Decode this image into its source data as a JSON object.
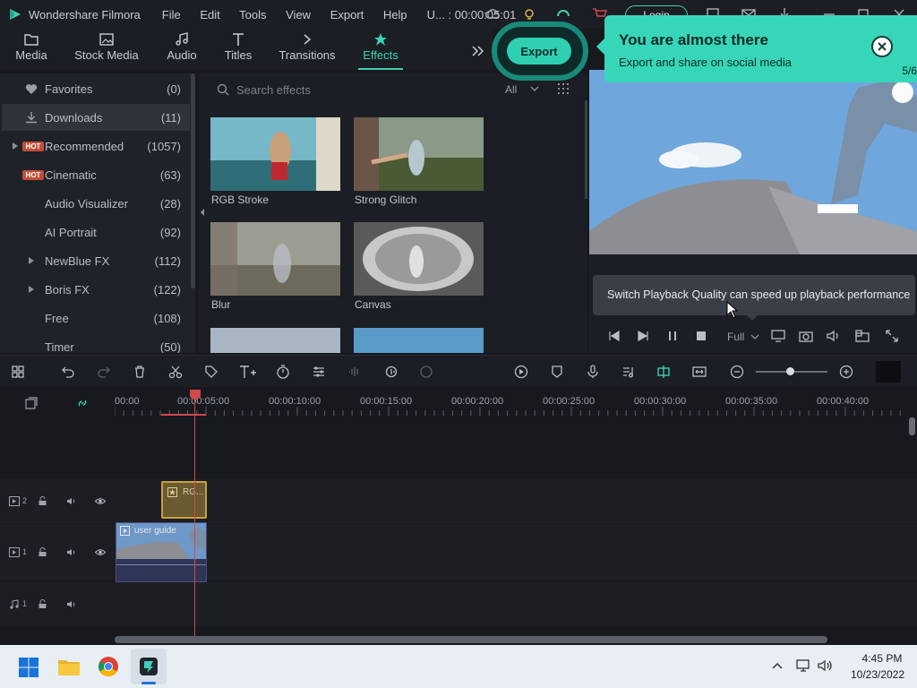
{
  "titlebar": {
    "app_name": "Wondershare Filmora",
    "menu": [
      "File",
      "Edit",
      "Tools",
      "View",
      "Export",
      "Help"
    ],
    "project": "U... : 00:00:05:01",
    "login_label": "Login"
  },
  "tabs": [
    {
      "label": "Media"
    },
    {
      "label": "Stock Media"
    },
    {
      "label": "Audio"
    },
    {
      "label": "Titles"
    },
    {
      "label": "Transitions"
    },
    {
      "label": "Effects"
    }
  ],
  "sidebar": {
    "items": [
      {
        "label": "Favorites",
        "count": "(0)"
      },
      {
        "label": "Downloads",
        "count": "(11)"
      },
      {
        "label": "Recommended",
        "count": "(1057)",
        "badge": "HOT"
      },
      {
        "label": "Cinematic",
        "count": "(63)",
        "badge": "HOT"
      },
      {
        "label": "Audio Visualizer",
        "count": "(28)"
      },
      {
        "label": "AI Portrait",
        "count": "(92)"
      },
      {
        "label": "NewBlue FX",
        "count": "(112)"
      },
      {
        "label": "Boris FX",
        "count": "(122)"
      },
      {
        "label": "Free",
        "count": "(108)"
      },
      {
        "label": "Timer",
        "count": "(50)"
      }
    ]
  },
  "effects": {
    "search_placeholder": "Search effects",
    "filter": "All",
    "items": [
      {
        "label": "RGB Stroke"
      },
      {
        "label": "Strong Glitch"
      },
      {
        "label": "Blur"
      },
      {
        "label": "Canvas"
      }
    ]
  },
  "export": {
    "button_label": "Export",
    "callout_title": "You are almost there",
    "callout_text": "Export and share on social media",
    "callout_page": "5/6"
  },
  "preview": {
    "tooltip": "Switch Playback Quality can speed up playback performance",
    "quality": "Full"
  },
  "timeline": {
    "ticks": [
      "00:00",
      "00:00:05:00",
      "00:00:10:00",
      "00:00:15:00",
      "00:00:20:00",
      "00:00:25:00",
      "00:00:30:00",
      "00:00:35:00",
      "00:00:40:00"
    ],
    "tracks": [
      {
        "label": "2"
      },
      {
        "label": "1"
      },
      {
        "label": "1"
      }
    ],
    "clips": [
      {
        "label": "RG..."
      },
      {
        "label": "user guide"
      }
    ]
  },
  "taskbar": {
    "time": "4:45 PM",
    "date": "10/23/2022"
  },
  "colors": {
    "accent": "#3fd0b5",
    "playhead": "#d04a4a"
  }
}
